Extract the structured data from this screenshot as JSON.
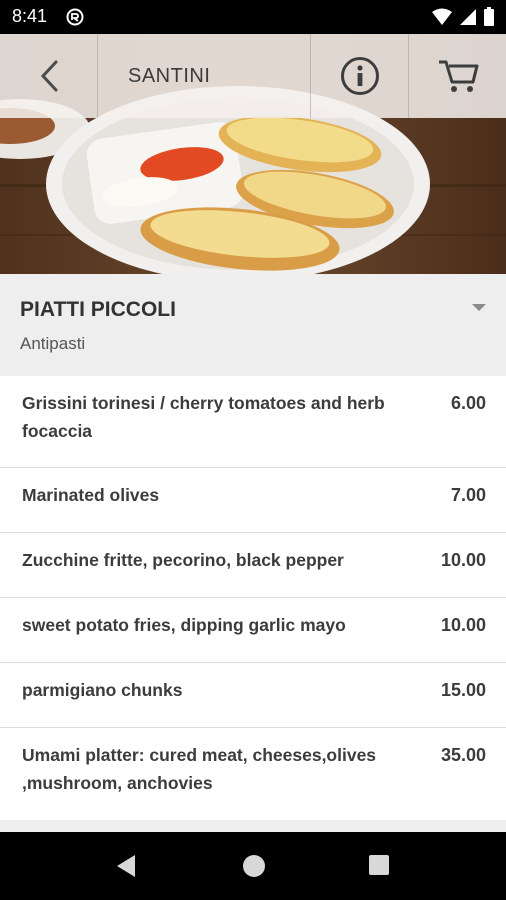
{
  "status_bar": {
    "time": "8:41"
  },
  "header": {
    "title": "SANTINI",
    "back_icon": "chevron-left-icon",
    "info_icon": "info-icon",
    "cart_icon": "cart-icon"
  },
  "section": {
    "title": "PIATTI PICCOLI",
    "subtitle": "Antipasti"
  },
  "items": [
    {
      "name": "Grissini torinesi / cherry tomatoes and herb focaccia",
      "price": "6.00"
    },
    {
      "name": "Marinated olives",
      "price": "7.00"
    },
    {
      "name": "Zucchine fritte, pecorino, black pepper",
      "price": "10.00"
    },
    {
      "name": "sweet potato fries, dipping garlic mayo",
      "price": "10.00"
    },
    {
      "name": "parmigiano chunks",
      "price": "15.00"
    },
    {
      "name": "Umami platter: cured meat, cheeses,olives ,mushroom, anchovies",
      "price": "35.00"
    }
  ]
}
